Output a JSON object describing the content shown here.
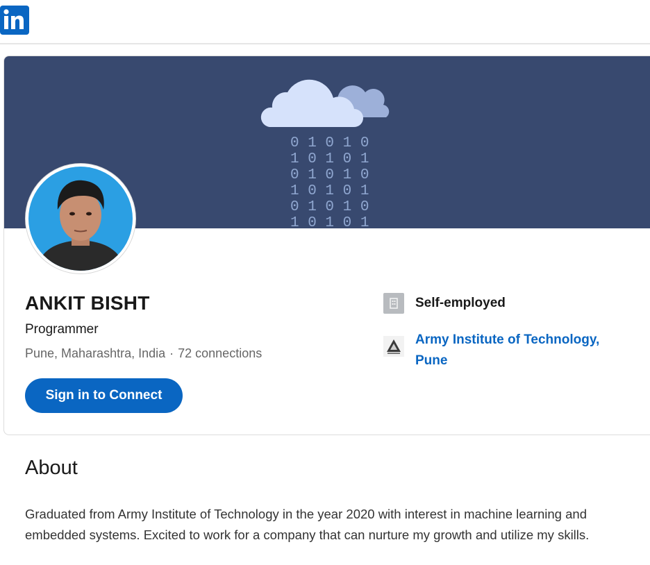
{
  "header": {
    "logo_icon": "linkedin-logo-icon",
    "accent": "#0a66c2"
  },
  "cover": {
    "background": "#38496f",
    "binary_rows": [
      "0 1 0 1 0",
      "1 0 1 0 1",
      "0 1 0 1 0",
      "1 0 1 0 1",
      "0 1 0 1 0",
      "1 0 1 0 1"
    ]
  },
  "profile": {
    "name": "ANKIT BISHT",
    "headline": "Programmer",
    "location": "Pune, Maharashtra, India",
    "separator": "·",
    "connections": "72 connections",
    "connect_button": "Sign in to Connect"
  },
  "experience": {
    "company_icon": "building-icon",
    "company": "Self-employed"
  },
  "education": {
    "school_icon": "school-logo-icon",
    "school": "Army Institute of Technology, Pune"
  },
  "about": {
    "title": "About",
    "text": "Graduated from Army Institute of Technology in the year 2020 with interest in machine learning and embedded systems. Excited to work for a company that can nurture my growth and utilize my skills."
  }
}
